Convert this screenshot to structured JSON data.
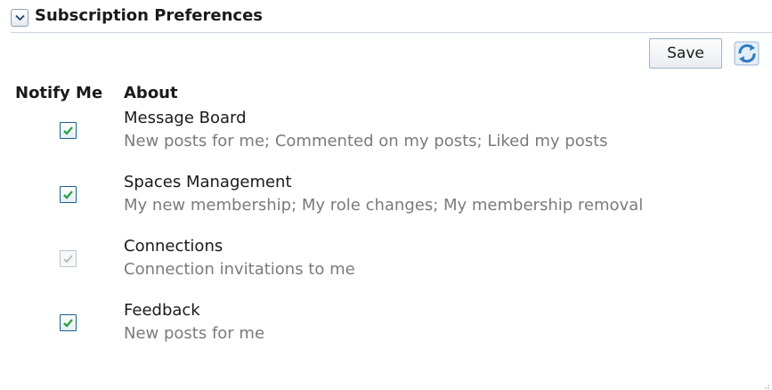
{
  "panel": {
    "title": "Subscription Preferences",
    "collapse_icon": "chevron-down-icon"
  },
  "toolbar": {
    "save_label": "Save",
    "refresh_icon": "refresh-icon"
  },
  "columns": {
    "notify": "Notify Me",
    "about": "About"
  },
  "items": [
    {
      "title": "Message Board",
      "description": "New posts for me; Commented on my posts; Liked my posts",
      "checked": true,
      "enabled": true
    },
    {
      "title": "Spaces Management",
      "description": "My new membership; My role changes; My membership removal",
      "checked": true,
      "enabled": true
    },
    {
      "title": "Connections",
      "description": "Connection invitations to me",
      "checked": true,
      "enabled": false
    },
    {
      "title": "Feedback",
      "description": "New posts for me",
      "checked": true,
      "enabled": true
    }
  ],
  "colors": {
    "check_enabled": "#2ea24a",
    "check_disabled": "#b7c2bb",
    "checkbox_border": "#1c5f8e",
    "description_text": "#7b7b7b"
  }
}
